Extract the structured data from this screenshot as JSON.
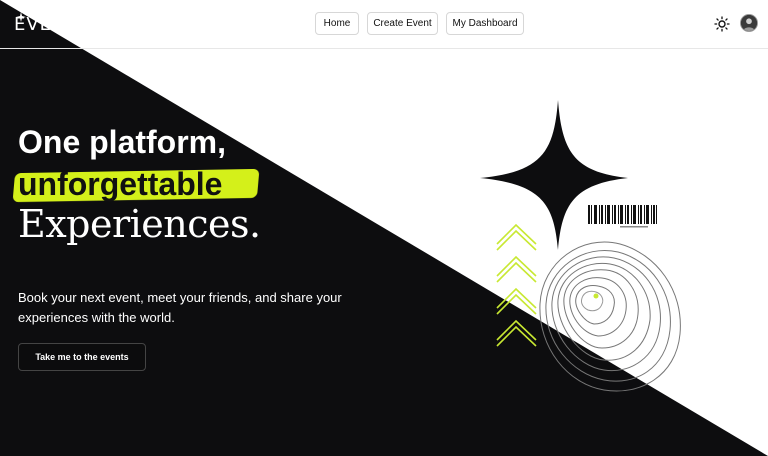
{
  "brand": {
    "name": "EVENTFUL",
    "logo_icon": "sparkle-icon"
  },
  "nav": {
    "items": [
      {
        "label": "Home"
      },
      {
        "label": "Create Event"
      },
      {
        "label": "My Dashboard"
      }
    ],
    "theme_icon": "sun-icon",
    "avatar_icon": "user-avatar-icon"
  },
  "hero": {
    "line1": "One platform,",
    "line2": "unforgettable",
    "line3": "Experiences.",
    "description": "Book your next event, meet your friends, and share your experiences with the world.",
    "cta": "Take me to the events"
  },
  "colors": {
    "dark": "#0d0d0f",
    "light": "#ffffff",
    "accent": "#d4f01a",
    "highlight_text": "#111111"
  },
  "art": {
    "icons": [
      "four-point-star-icon",
      "barcode-icon",
      "chevron-stack-icon",
      "topographic-rings-icon"
    ]
  }
}
